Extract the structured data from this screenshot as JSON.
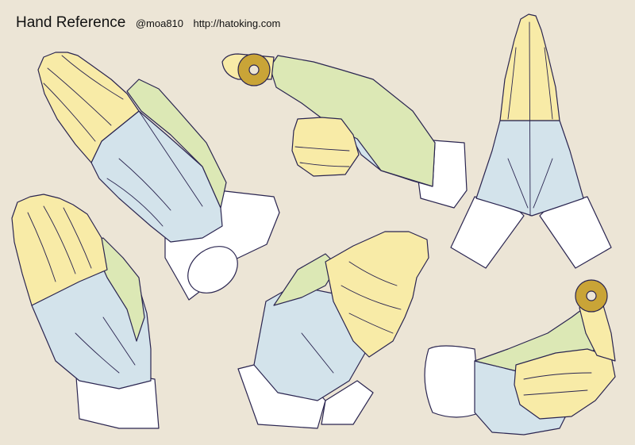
{
  "header": {
    "title": "Hand Reference",
    "author_handle": "@moa810",
    "website": "http://hatoking.com"
  },
  "colors": {
    "background": "#ECE5D6",
    "fingers": "#F8EBA7",
    "palm": "#D3E3EB",
    "thumb": "#DCE8B5",
    "sleeve": "#FFFFFF",
    "outline": "#2A2550",
    "coin": "#C9A437"
  },
  "figures": [
    {
      "id": "praying-hands-side-large",
      "icon": "praying-hands-icon"
    },
    {
      "id": "hand-holding-coin-pointing",
      "icon": "coin-icon"
    },
    {
      "id": "praying-hands-front",
      "icon": "praying-hands-icon"
    },
    {
      "id": "praying-hands-side-small",
      "icon": "praying-hands-icon"
    },
    {
      "id": "praying-hands-angled",
      "icon": "praying-hands-icon"
    },
    {
      "id": "fist-holding-coin-up",
      "icon": "coin-icon"
    }
  ]
}
